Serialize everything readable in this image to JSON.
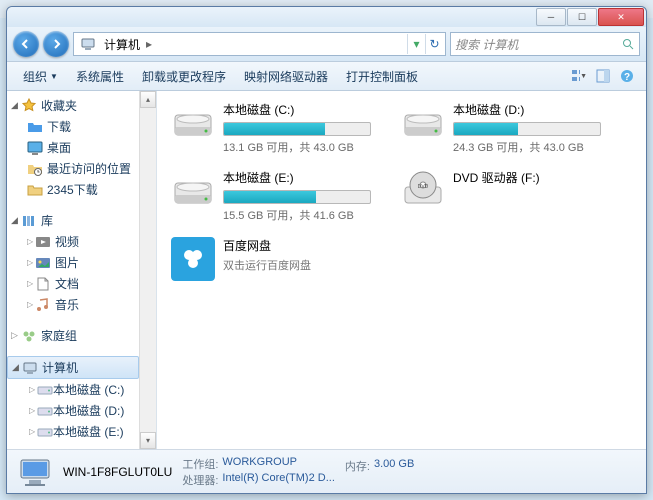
{
  "address": {
    "location": "计算机",
    "refresh_glyph": "↻",
    "drop_glyph": "▾"
  },
  "search": {
    "placeholder": "搜索 计算机"
  },
  "toolbar": {
    "organize": "组织",
    "sys_props": "系统属性",
    "uninstall": "卸载或更改程序",
    "map_drive": "映射网络驱动器",
    "control_panel": "打开控制面板"
  },
  "sidebar": {
    "favorites": {
      "label": "收藏夹",
      "items": [
        "下载",
        "桌面",
        "最近访问的位置",
        "2345下载"
      ]
    },
    "libraries": {
      "label": "库",
      "items": [
        "视频",
        "图片",
        "文档",
        "音乐"
      ]
    },
    "homegroup": {
      "label": "家庭组"
    },
    "computer": {
      "label": "计算机",
      "items": [
        "本地磁盘 (C:)",
        "本地磁盘 (D:)",
        "本地磁盘 (E:)"
      ]
    }
  },
  "drives": {
    "c": {
      "name": "本地磁盘 (C:)",
      "text": "13.1 GB 可用，共 43.0 GB",
      "fill": 69
    },
    "d": {
      "name": "本地磁盘 (D:)",
      "text": "24.3 GB 可用，共 43.0 GB",
      "fill": 44
    },
    "e": {
      "name": "本地磁盘 (E:)",
      "text": "15.5 GB 可用，共 41.6 GB",
      "fill": 63
    },
    "dvd": {
      "name": "DVD 驱动器 (F:)"
    },
    "baidu": {
      "name": "百度网盘",
      "sub": "双击运行百度网盘"
    }
  },
  "status": {
    "name": "WIN-1F8FGLUT0LU",
    "workgroup_lbl": "工作组:",
    "workgroup_val": "WORKGROUP",
    "cpu_lbl": "处理器:",
    "cpu_val": "Intel(R) Core(TM)2 D...",
    "mem_lbl": "内存:",
    "mem_val": "3.00 GB"
  }
}
